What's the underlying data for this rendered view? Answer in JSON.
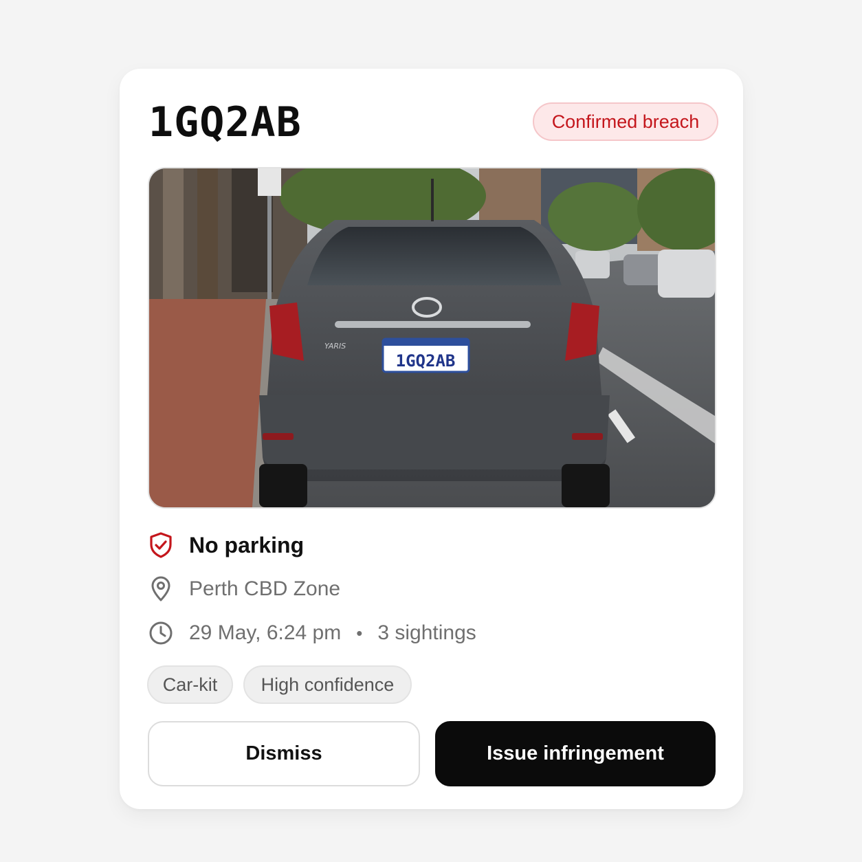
{
  "plate": "1GQ2AB",
  "status": {
    "label": "Confirmed breach",
    "color": "#c4161c",
    "background": "#fde8e9"
  },
  "photo": {
    "description_icon": "vehicle-photo",
    "plate_text": "1GQ2AB",
    "badge_text": "YARIS"
  },
  "details": {
    "rule": {
      "icon": "shield-check-icon",
      "label": "No parking"
    },
    "location": {
      "icon": "map-pin-icon",
      "label": "Perth CBD Zone"
    },
    "time": {
      "icon": "clock-icon",
      "timestamp": "29 May, 6:24 pm",
      "separator": "•",
      "sightings": "3 sightings"
    }
  },
  "tags": [
    "Car-kit",
    "High confidence"
  ],
  "actions": {
    "dismiss": "Dismiss",
    "issue": "Issue infringement"
  },
  "colors": {
    "accent": "#c4161c",
    "primary_button": "#0b0b0b",
    "muted_text": "#6f6f6f"
  }
}
